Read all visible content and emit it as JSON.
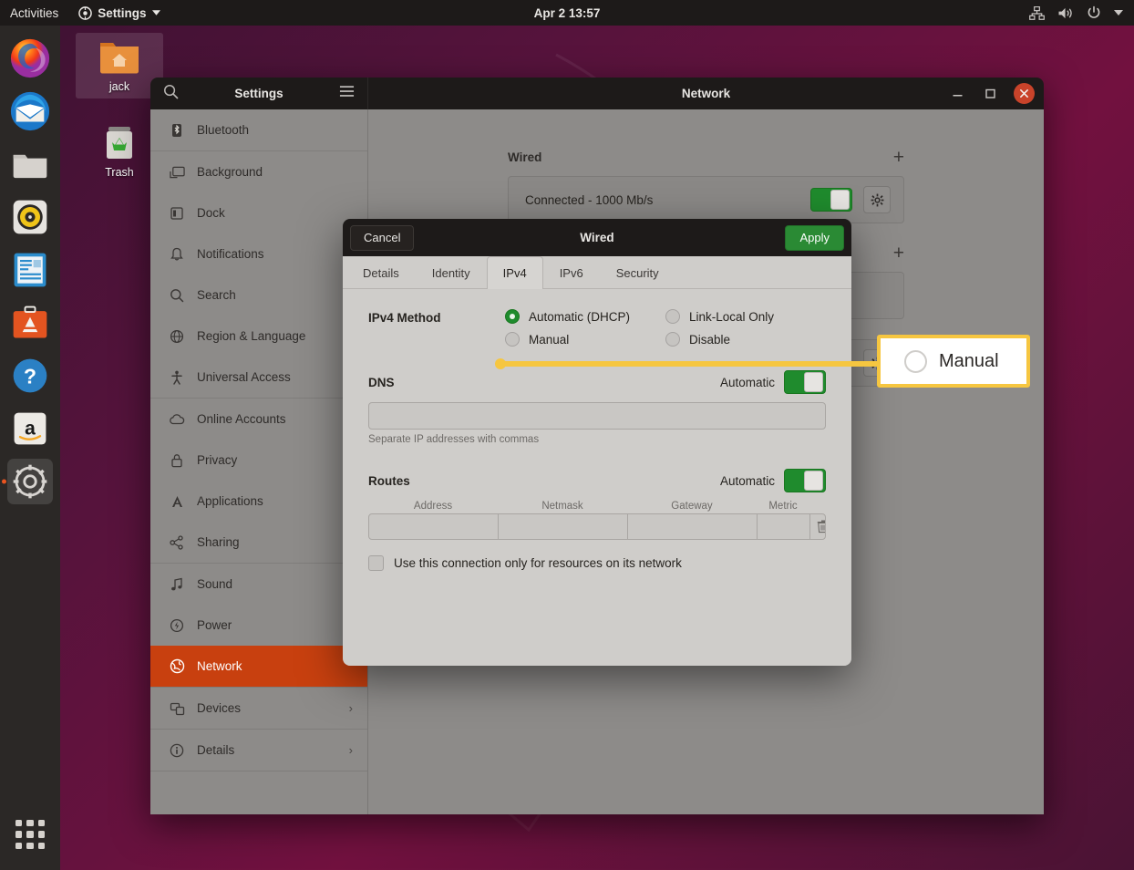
{
  "topbar": {
    "activities": "Activities",
    "app_menu": "Settings",
    "app_menu_icon": "settings-gear-icon",
    "clock": "Apr 2  13:57",
    "indicators": [
      "network-icon",
      "volume-icon",
      "power-icon",
      "chevron-down-icon"
    ]
  },
  "dock": {
    "items": [
      {
        "name": "firefox",
        "label": "Firefox"
      },
      {
        "name": "thunderbird",
        "label": "Thunderbird Mail"
      },
      {
        "name": "files",
        "label": "Files"
      },
      {
        "name": "rhythmbox",
        "label": "Rhythmbox"
      },
      {
        "name": "libreoffice-writer",
        "label": "LibreOffice Writer"
      },
      {
        "name": "ubuntu-software",
        "label": "Ubuntu Software"
      },
      {
        "name": "help",
        "label": "Help"
      },
      {
        "name": "amazon",
        "label": "Amazon"
      },
      {
        "name": "settings",
        "label": "Settings"
      }
    ],
    "show_applications": "Show Applications"
  },
  "desktop": {
    "icons": [
      {
        "name": "home-folder",
        "label": "jack",
        "selected": true
      },
      {
        "name": "trash",
        "label": "Trash",
        "selected": false
      }
    ]
  },
  "settings_window": {
    "sidebar_header_title": "Settings",
    "search_icon": "search-icon",
    "menu_icon": "hamburger-menu-icon",
    "window_title": "Network",
    "controls": {
      "minimize": "minimize",
      "maximize": "maximize",
      "close": "close"
    },
    "sidebar_items": [
      {
        "label": "Bluetooth",
        "icon": "bluetooth-icon",
        "selected": false,
        "chevron": false
      },
      {
        "label": "Background",
        "icon": "background-icon",
        "selected": false,
        "chevron": false
      },
      {
        "label": "Dock",
        "icon": "dock-icon",
        "selected": false,
        "chevron": false
      },
      {
        "label": "Notifications",
        "icon": "bell-icon",
        "selected": false,
        "chevron": false
      },
      {
        "label": "Search",
        "icon": "search-icon",
        "selected": false,
        "chevron": false
      },
      {
        "label": "Region & Language",
        "icon": "globe-icon",
        "selected": false,
        "chevron": false
      },
      {
        "label": "Universal Access",
        "icon": "accessibility-icon",
        "selected": false,
        "chevron": false
      },
      {
        "label": "Online Accounts",
        "icon": "cloud-icon",
        "selected": false,
        "chevron": false
      },
      {
        "label": "Privacy",
        "icon": "lock-icon",
        "selected": false,
        "chevron": false
      },
      {
        "label": "Applications",
        "icon": "applications-icon",
        "selected": false,
        "chevron": false
      },
      {
        "label": "Sharing",
        "icon": "share-icon",
        "selected": false,
        "chevron": false
      },
      {
        "label": "Sound",
        "icon": "music-note-icon",
        "selected": false,
        "chevron": false
      },
      {
        "label": "Power",
        "icon": "power-icon",
        "selected": false,
        "chevron": false
      },
      {
        "label": "Network",
        "icon": "network-globe-icon",
        "selected": true,
        "chevron": false
      },
      {
        "label": "Devices",
        "icon": "devices-icon",
        "selected": false,
        "chevron": true
      },
      {
        "label": "Details",
        "icon": "info-icon",
        "selected": false,
        "chevron": true
      }
    ]
  },
  "network_panel": {
    "sections": [
      {
        "title": "Wired",
        "add_icon": "plus-icon",
        "row_label": "Connected - 1000 Mb/s",
        "toggle_on": true,
        "gear_icon": "gear-icon"
      },
      {
        "title": "",
        "add_icon": "plus-icon",
        "row_label": "",
        "toggle_on": false,
        "gear_icon": "gear-icon"
      }
    ]
  },
  "dialog": {
    "cancel_label": "Cancel",
    "title": "Wired",
    "apply_label": "Apply",
    "tabs": [
      {
        "label": "Details",
        "active": false
      },
      {
        "label": "Identity",
        "active": false
      },
      {
        "label": "IPv4",
        "active": true
      },
      {
        "label": "IPv6",
        "active": false
      },
      {
        "label": "Security",
        "active": false
      }
    ],
    "ipv4_method": {
      "label": "IPv4 Method",
      "options": [
        {
          "label": "Automatic (DHCP)",
          "selected": true
        },
        {
          "label": "Link-Local Only",
          "selected": false
        },
        {
          "label": "Manual",
          "selected": false
        },
        {
          "label": "Disable",
          "selected": false
        }
      ]
    },
    "dns": {
      "title": "DNS",
      "auto_label": "Automatic",
      "auto_on": true,
      "value": "",
      "placeholder": "",
      "hint": "Separate IP addresses with commas"
    },
    "routes": {
      "title": "Routes",
      "auto_label": "Automatic",
      "auto_on": true,
      "columns": [
        "Address",
        "Netmask",
        "Gateway",
        "Metric"
      ],
      "rows": [
        {
          "address": "",
          "netmask": "",
          "gateway": "",
          "metric": ""
        }
      ],
      "delete_icon": "trash-icon"
    },
    "restrict_checkbox": {
      "label": "Use this connection only for resources on its network",
      "checked": false
    }
  },
  "annotation": {
    "callout_label": "Manual",
    "line_color": "#f6c640",
    "border_color": "#f6c640",
    "target": "Manual radio option"
  },
  "colors": {
    "accent_orange": "#c8400f",
    "apply_green": "#2a8a34",
    "toggle_green": "#1f8b2d",
    "close_button": "#c9432a",
    "annotation_yellow": "#f6c640"
  }
}
